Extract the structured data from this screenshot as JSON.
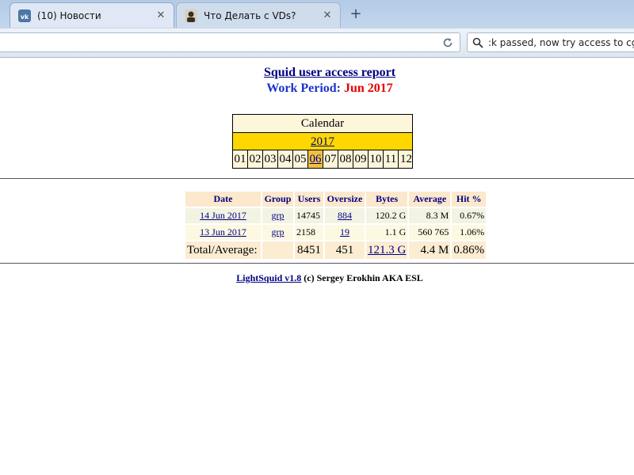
{
  "browser": {
    "tabs": [
      {
        "title": "(10) Новости",
        "icon": "vk-logo-icon",
        "active": true
      },
      {
        "title": "Что Делать с VDs?",
        "icon": "user-avatar-icon",
        "active": false
      }
    ],
    "close_glyph": "✕",
    "newtab_glyph": "+",
    "url": "",
    "search_text": ":k passed, now try access to cgi part"
  },
  "report": {
    "title": "Squid user access report",
    "work_period_label": "Work Period:",
    "work_period_value": "Jun 2017"
  },
  "calendar": {
    "header": "Calendar",
    "year": "2017",
    "months": [
      "01",
      "02",
      "03",
      "04",
      "05",
      "06",
      "07",
      "08",
      "09",
      "10",
      "11",
      "12"
    ],
    "active_month": "06"
  },
  "table": {
    "headers": [
      "Date",
      "Group",
      "Users",
      "Oversize",
      "Bytes",
      "Average",
      "Hit %"
    ],
    "rows": [
      {
        "date": "14 Jun 2017",
        "group": "grp",
        "users": "14745",
        "oversize": "884",
        "bytes": "120.2 G",
        "average": "8.3 M",
        "hit": "0.67%"
      },
      {
        "date": "13 Jun 2017",
        "group": "grp",
        "users": "2158",
        "oversize": "19",
        "bytes": "1.1 G",
        "average": "560 765",
        "hit": "1.06%"
      }
    ],
    "total": {
      "label": "Total/Average:",
      "group": "",
      "users": "8451",
      "oversize": "451",
      "bytes": "121.3 G",
      "average": "4.4 M",
      "hit": "0.86%"
    }
  },
  "footer": {
    "link": "LightSquid v1.8",
    "text": " (c) Sergey Erokhin AKA ESL"
  },
  "colors": {
    "title_link": "#000080",
    "work_period_label": "#1a33cc",
    "work_period_value": "#e60000",
    "calendar_year_bg": "#ffd700",
    "calendar_bg": "#fdf6db",
    "active_month_bg": "#f0c040",
    "table_header_bg": "#fce8cc"
  }
}
